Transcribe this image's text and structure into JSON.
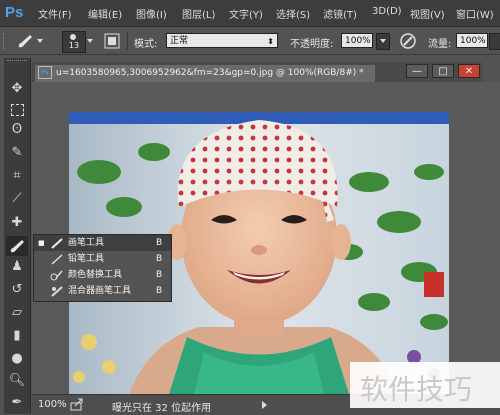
{
  "app": {
    "logo": "Ps"
  },
  "menubar": {
    "items": [
      "文件(F)",
      "编辑(E)",
      "图像(I)",
      "图层(L)",
      "文字(Y)",
      "选择(S)",
      "滤镜(T)",
      "3D(D)",
      "视图(V)",
      "窗口(W)"
    ]
  },
  "options": {
    "brush_size": "13",
    "mode_label": "模式:",
    "mode_value": "正常",
    "opacity_label": "不透明度:",
    "opacity_value": "100%",
    "flow_label": "流量:",
    "flow_value": "100%"
  },
  "document": {
    "tab_title": "u=1603580965,3006952962&fm=23&gp=0.jpg @ 100%(RGB/8#) *",
    "close_symbol": "×"
  },
  "window_buttons": {
    "minimize": "—",
    "maximize": "□",
    "close": "✕"
  },
  "flyout": {
    "items": [
      {
        "label": "画笔工具",
        "shortcut": "B",
        "selected": true
      },
      {
        "label": "铅笔工具",
        "shortcut": "B",
        "selected": false
      },
      {
        "label": "颜色替换工具",
        "shortcut": "B",
        "selected": false
      },
      {
        "label": "混合器画笔工具",
        "shortcut": "B",
        "selected": false
      }
    ]
  },
  "status": {
    "zoom": "100%",
    "info": "曝光只在 32 位起作用"
  },
  "watermark": {
    "text": "软件技巧"
  },
  "colors": {
    "accent": "#4aa3f0",
    "panel": "#535353",
    "dark": "#3d3d3d"
  }
}
